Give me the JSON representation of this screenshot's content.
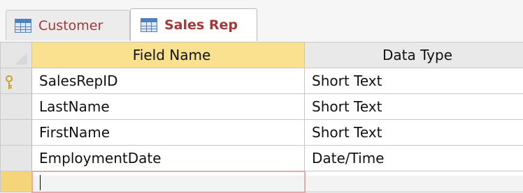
{
  "tabs": [
    {
      "label": "Customer",
      "active": false,
      "icon": "table-icon"
    },
    {
      "label": "Sales Rep",
      "active": true,
      "icon": "table-icon"
    }
  ],
  "grid": {
    "headers": {
      "field_name": "Field Name",
      "data_type": "Data Type"
    },
    "rows": [
      {
        "field_name": "SalesRepID",
        "data_type": "Short Text",
        "primary_key": true
      },
      {
        "field_name": "LastName",
        "data_type": "Short Text",
        "primary_key": false
      },
      {
        "field_name": "FirstName",
        "data_type": "Short Text",
        "primary_key": false
      },
      {
        "field_name": "EmploymentDate",
        "data_type": "Date/Time",
        "primary_key": false
      }
    ],
    "new_row": {
      "field_name": "",
      "data_type": ""
    }
  },
  "colors": {
    "tab_text": "#a4373a",
    "header_highlight": "#f9e190",
    "key_icon": "#c9a227"
  }
}
